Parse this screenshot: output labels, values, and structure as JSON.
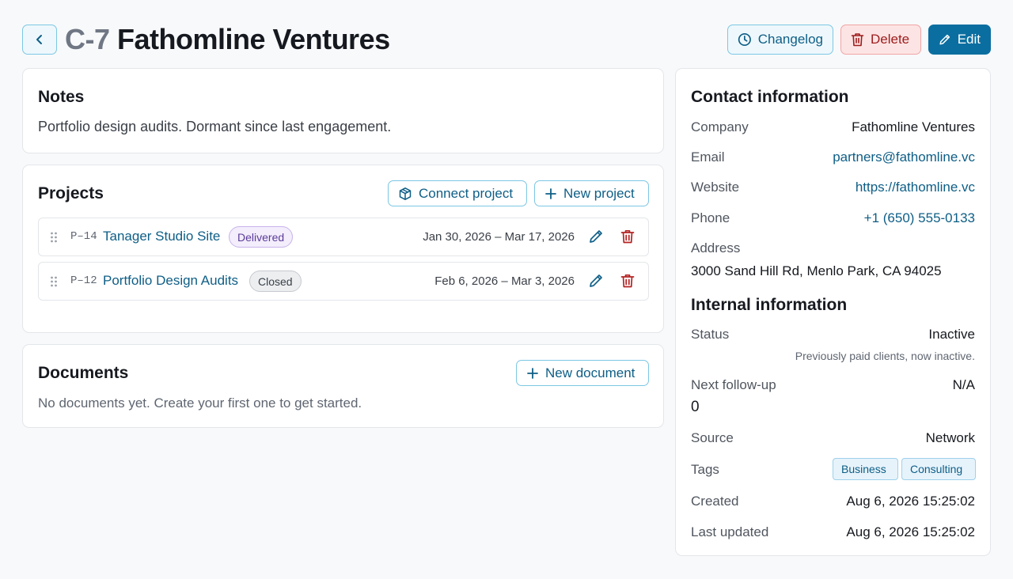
{
  "header": {
    "code": "C-7",
    "name": "Fathomline Ventures",
    "buttons": {
      "changelog": "Changelog",
      "delete": "Delete",
      "edit": "Edit"
    }
  },
  "notes": {
    "title": "Notes",
    "text": "Portfolio design audits. Dormant since last engagement."
  },
  "projects": {
    "title": "Projects",
    "connect_label": "Connect project",
    "new_label": "New project",
    "items": [
      {
        "code": "P–14",
        "name": "Tanager Studio Site",
        "status": "Delivered",
        "dates": "Jan 30, 2026 – Mar 17, 2026"
      },
      {
        "code": "P–12",
        "name": "Portfolio Design Audits",
        "status": "Closed",
        "dates": "Feb 6, 2026 – Mar 3, 2026"
      }
    ]
  },
  "documents": {
    "title": "Documents",
    "new_label": "New document",
    "empty_text": "No documents yet. Create your first one to get started."
  },
  "contact": {
    "title": "Contact information",
    "company_label": "Company",
    "company": "Fathomline Ventures",
    "email_label": "Email",
    "email": "partners@fathomline.vc",
    "website_label": "Website",
    "website": "https://fathomline.vc",
    "phone_label": "Phone",
    "phone": "+1 (650) 555-0133",
    "address_label": "Address",
    "address": "3000 Sand Hill Rd, Menlo Park, CA 94025"
  },
  "internal": {
    "title": "Internal information",
    "status_label": "Status",
    "status": "Inactive",
    "status_note": "Previously paid clients, now inactive.",
    "followup_label": "Next follow-up",
    "followup": "N/A",
    "followup_extra": "0",
    "source_label": "Source",
    "source": "Network",
    "tags_label": "Tags",
    "tags": [
      "Business",
      "Consulting"
    ],
    "created_label": "Created",
    "created": "Aug 6, 2026 15:25:02",
    "updated_label": "Last updated",
    "updated": "Aug 6, 2026 15:25:02"
  },
  "colors": {
    "accent": "#0b6ea0",
    "link": "#0e5e86",
    "danger": "#9d1c1c",
    "delivered_badge": "#f3edfc",
    "closed_badge": "#eceef0"
  },
  "icons": {
    "back": "chevron-left-icon",
    "changelog": "clock-icon",
    "delete": "trash-icon",
    "edit": "pencil-icon",
    "connect": "box-icon",
    "new": "plus-icon",
    "drag": "drag-handle-icon"
  }
}
